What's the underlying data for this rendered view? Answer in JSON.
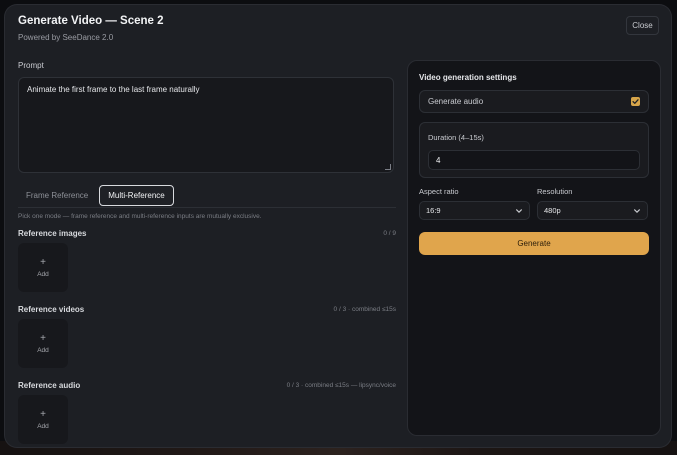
{
  "dialog": {
    "title": "Generate Video — Scene 2",
    "subtitle": "Powered by SeeDance 2.0",
    "close_label": "Close"
  },
  "prompt": {
    "label": "Prompt",
    "value": "Animate the first frame to the last frame naturally"
  },
  "mode_tabs": {
    "items": [
      {
        "label": "Frame Reference",
        "active": false
      },
      {
        "label": "Multi-Reference",
        "active": true
      }
    ],
    "hint": "Pick one mode — frame reference and multi-reference inputs are mutually exclusive."
  },
  "references": [
    {
      "title": "Reference images",
      "meta": "0 / 9",
      "add_label": "Add",
      "add_icon": "plus-icon"
    },
    {
      "title": "Reference videos",
      "meta": "0 / 3 · combined ≤15s",
      "add_label": "Add",
      "add_icon": "plus-icon"
    },
    {
      "title": "Reference audio",
      "meta": "0 / 3 · combined ≤15s — lipsync/voice",
      "add_label": "Add",
      "add_icon": "plus-icon"
    }
  ],
  "settings": {
    "title": "Video generation settings",
    "generate_audio": {
      "label": "Generate audio",
      "checked": true
    },
    "duration": {
      "label": "Duration (4–15s)",
      "value": "4"
    },
    "aspect_ratio": {
      "label": "Aspect ratio",
      "value": "16:9"
    },
    "resolution": {
      "label": "Resolution",
      "value": "480p"
    },
    "generate_label": "Generate"
  },
  "colors": {
    "accent": "#e0a54c",
    "panel": "#131418",
    "modal": "#1d1f24"
  }
}
